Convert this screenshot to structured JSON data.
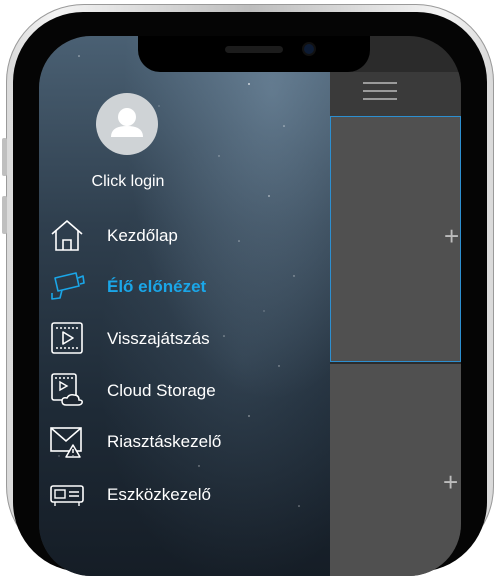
{
  "profile": {
    "login_text": "Click login"
  },
  "menu": {
    "items": [
      {
        "label": "Kezdőlap",
        "icon": "home-icon",
        "active": false
      },
      {
        "label": "Élő előnézet",
        "icon": "camera-icon",
        "active": true
      },
      {
        "label": "Visszajátszás",
        "icon": "playback-icon",
        "active": false
      },
      {
        "label": "Cloud Storage",
        "icon": "cloud-storage-icon",
        "active": false
      },
      {
        "label": "Riasztáskezelő",
        "icon": "alarm-icon",
        "active": false
      },
      {
        "label": "Eszközkezelő",
        "icon": "device-icon",
        "active": false
      }
    ]
  },
  "preview": {
    "add_symbol_1": "+",
    "add_symbol_2": "+"
  },
  "colors": {
    "accent": "#1aa6e8",
    "drawer_top": "#4a6073",
    "drawer_bottom": "#151d26",
    "pane_background": "#505050",
    "pane_border": "#2d8fd0"
  }
}
